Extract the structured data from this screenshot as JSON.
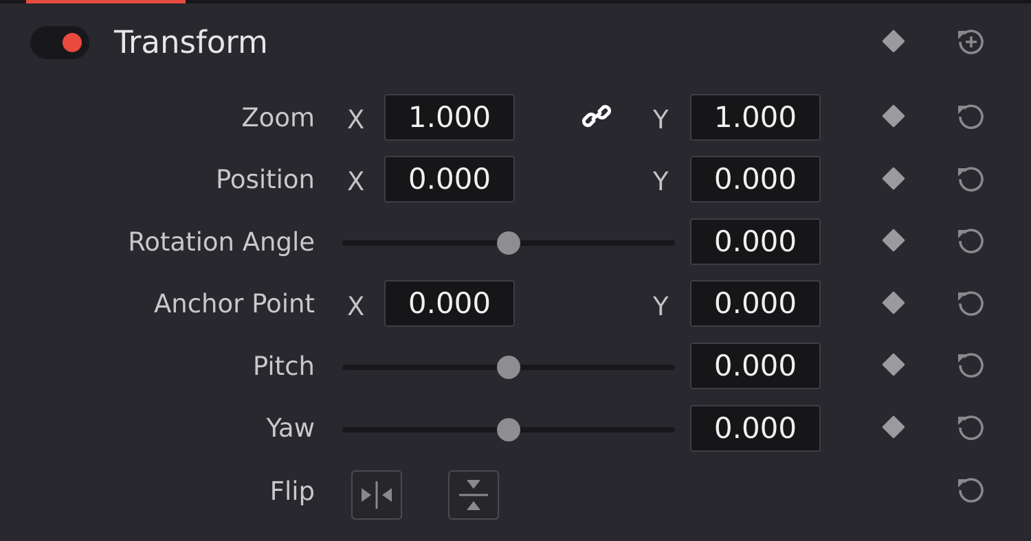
{
  "panel": {
    "title": "Transform",
    "enabled": true,
    "accent_color": "#e64b3d"
  },
  "rows": {
    "zoom": {
      "label": "Zoom",
      "x_label": "X",
      "x_value": "1.000",
      "y_label": "Y",
      "y_value": "1.000",
      "linked": true
    },
    "position": {
      "label": "Position",
      "x_label": "X",
      "x_value": "0.000",
      "y_label": "Y",
      "y_value": "0.000"
    },
    "rotation": {
      "label": "Rotation Angle",
      "value": "0.000",
      "slider_level": 0.5
    },
    "anchor": {
      "label": "Anchor Point",
      "x_label": "X",
      "x_value": "0.000",
      "y_label": "Y",
      "y_value": "0.000"
    },
    "pitch": {
      "label": "Pitch",
      "value": "0.000",
      "slider_level": 0.5
    },
    "yaw": {
      "label": "Yaw",
      "value": "0.000",
      "slider_level": 0.5
    },
    "flip": {
      "label": "Flip"
    }
  },
  "icons": {
    "header_reset": "reset-all-icon",
    "keyframe": "keyframe-diamond-icon",
    "reset": "reset-icon",
    "link": "link-icon",
    "flip_horizontal": "flip-horizontal-icon",
    "flip_vertical": "flip-vertical-icon"
  }
}
